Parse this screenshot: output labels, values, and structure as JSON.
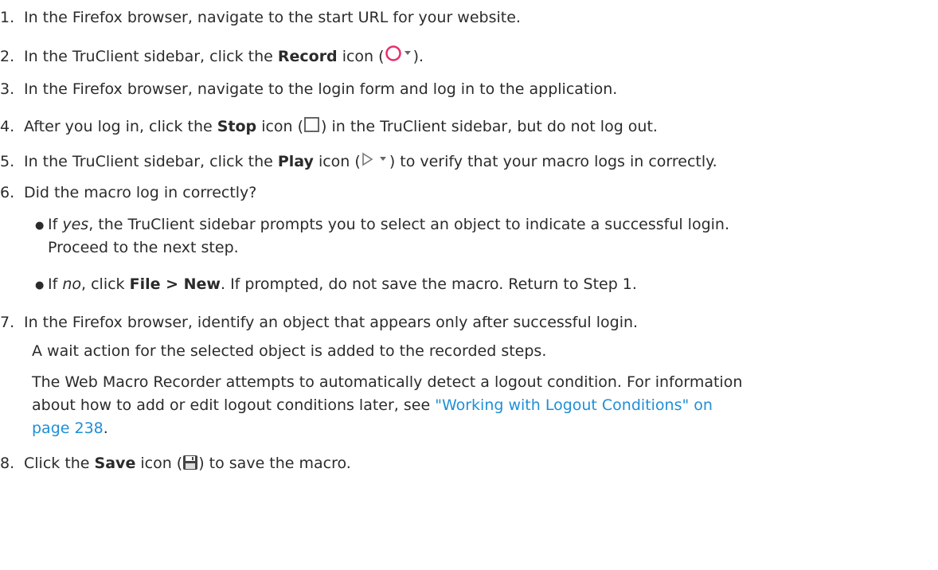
{
  "steps": {
    "s1": {
      "num": "1.",
      "text": "In the Firefox browser, navigate to the start URL for your website."
    },
    "s2": {
      "num": "2.",
      "pre": "In the TruClient sidebar, click the ",
      "bold": "Record",
      "mid": " icon (",
      "post": ")."
    },
    "s3": {
      "num": "3.",
      "text": "In the Firefox browser, navigate to the login form and log in to the application."
    },
    "s4": {
      "num": "4.",
      "pre": "After you log in, click the ",
      "bold": "Stop",
      "mid": " icon (",
      "post": ") in the TruClient sidebar, but do not log out."
    },
    "s5": {
      "num": "5.",
      "pre": "In the TruClient sidebar, click the ",
      "bold": "Play",
      "mid": " icon (",
      "post": ") to verify that your macro logs in correctly."
    },
    "s6": {
      "num": "6.",
      "text": "Did the macro log in correctly?"
    },
    "s6a": {
      "italic": "yes",
      "text1": ", the TruClient sidebar prompts you to select an object to indicate a successful login.",
      "text2": "Proceed to the next step."
    },
    "s6b": {
      "italic": "no",
      "mid": ", click ",
      "bold": "File > New",
      "post": ". If prompted, do not save the macro. Return to Step 1."
    },
    "s7": {
      "num": "7.",
      "text": "In the Firefox browser, identify an object that appears only after successful login.",
      "p1": "A wait action for the selected object is added to the recorded steps.",
      "p2a": "The Web Macro Recorder attempts to automatically detect a logout condition. For information",
      "p2b": "about how to add or edit logout conditions later, see ",
      "link1": "\"Working with Logout Conditions\" on",
      "link2": "page 238",
      "p2end": "."
    },
    "s8": {
      "num": "8.",
      "pre": "Click the ",
      "bold": "Save",
      "mid": " icon (",
      "post": ") to save the macro."
    },
    "if_label": "If "
  },
  "colors": {
    "record_icon": "#e6306e",
    "link": "#1f8fd6",
    "text": "#2b2b2b"
  }
}
